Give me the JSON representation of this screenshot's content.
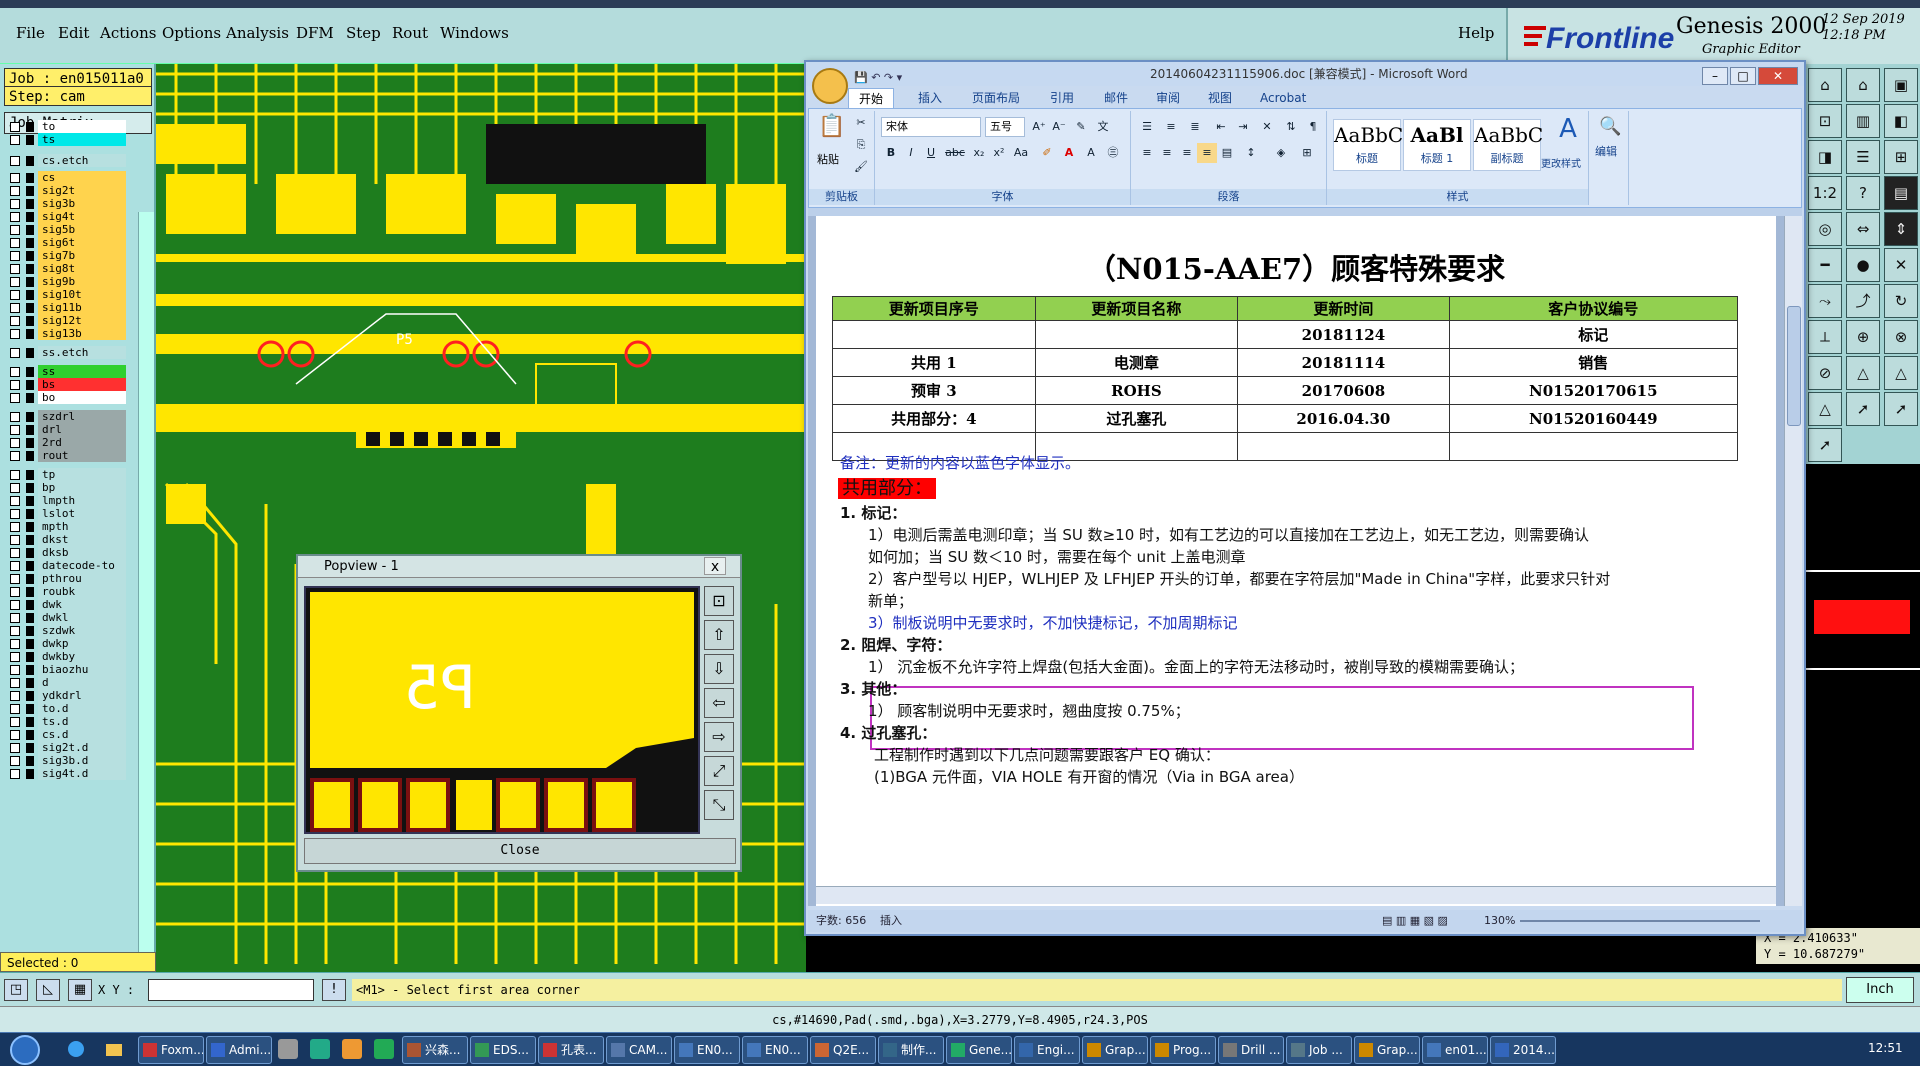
{
  "genesis": {
    "menus": [
      "File",
      "Edit",
      "Actions",
      "Options",
      "Analysis",
      "DFM",
      "Step",
      "Rout",
      "Windows"
    ],
    "help": "Help",
    "brand": {
      "logo_text": "Frontline",
      "product": "Genesis 2000",
      "subtitle": "Graphic Editor",
      "date": "12 Sep 2019",
      "time": "12:18 PM"
    },
    "job_label": "Job : en015011a0",
    "step_label": "Step: cam",
    "job_matrix": "Job Matrix ...",
    "layers": [
      {
        "name": "to",
        "color": "#ffffff"
      },
      {
        "name": "ts",
        "color": "#00e8e8"
      },
      {
        "name": "cs.etch",
        "color": "#b7e0e0"
      },
      {
        "name": "cs",
        "color": "#ffd34d"
      },
      {
        "name": "sig2t",
        "color": "#ffd34d"
      },
      {
        "name": "sig3b",
        "color": "#ffd34d"
      },
      {
        "name": "sig4t",
        "color": "#ffd34d"
      },
      {
        "name": "sig5b",
        "color": "#ffd34d"
      },
      {
        "name": "sig6t",
        "color": "#ffd34d"
      },
      {
        "name": "sig7b",
        "color": "#ffd34d"
      },
      {
        "name": "sig8t",
        "color": "#ffd34d"
      },
      {
        "name": "sig9b",
        "color": "#ffd34d"
      },
      {
        "name": "sig10t",
        "color": "#ffd34d"
      },
      {
        "name": "sig11b",
        "color": "#ffd34d"
      },
      {
        "name": "sig12t",
        "color": "#ffd34d"
      },
      {
        "name": "sig13b",
        "color": "#ffd34d"
      },
      {
        "name": "ss.etch",
        "color": "#b7e0e0"
      },
      {
        "name": "ss",
        "color": "#2fd02f"
      },
      {
        "name": "bs",
        "color": "#ff3030"
      },
      {
        "name": "bo",
        "color": "#ffffff"
      },
      {
        "name": "szdrl",
        "color": "#9aa8a8"
      },
      {
        "name": "drl",
        "color": "#9aa8a8"
      },
      {
        "name": "2rd",
        "color": "#9aa8a8"
      },
      {
        "name": "rout",
        "color": "#9aa8a8"
      },
      {
        "name": "tp",
        "color": "#b7e0e0"
      },
      {
        "name": "bp",
        "color": "#b7e0e0"
      },
      {
        "name": "lmpth",
        "color": "#b7e0e0"
      },
      {
        "name": "lslot",
        "color": "#b7e0e0"
      },
      {
        "name": "mpth",
        "color": "#b7e0e0"
      },
      {
        "name": "dkst",
        "color": "#b7e0e0"
      },
      {
        "name": "dksb",
        "color": "#b7e0e0"
      },
      {
        "name": "datecode-to",
        "color": "#b7e0e0"
      },
      {
        "name": "pthrou",
        "color": "#b7e0e0"
      },
      {
        "name": "roubk",
        "color": "#b7e0e0"
      },
      {
        "name": "dwk",
        "color": "#b7e0e0"
      },
      {
        "name": "dwkl",
        "color": "#b7e0e0"
      },
      {
        "name": "szdwk",
        "color": "#b7e0e0"
      },
      {
        "name": "dwkp",
        "color": "#b7e0e0"
      },
      {
        "name": "dwkby",
        "color": "#b7e0e0"
      },
      {
        "name": "biaozhu",
        "color": "#b7e0e0"
      },
      {
        "name": "d",
        "color": "#b7e0e0"
      },
      {
        "name": "ydkdrl",
        "color": "#b7e0e0"
      },
      {
        "name": "to.d",
        "color": "#b7e0e0"
      },
      {
        "name": "ts.d",
        "color": "#b7e0e0"
      },
      {
        "name": "cs.d",
        "color": "#b7e0e0"
      },
      {
        "name": "sig2t.d",
        "color": "#b7e0e0"
      },
      {
        "name": "sig3b.d",
        "color": "#b7e0e0"
      },
      {
        "name": "sig4t.d",
        "color": "#b7e0e0"
      }
    ],
    "selected": "Selected : 0",
    "popview": {
      "title": "Popview - 1",
      "close_x": "x",
      "close": "Close",
      "pad_label": "P5"
    },
    "board_label": "P5",
    "cmd": {
      "xy_label": "X Y :",
      "prompt": "<M1> - Select first area corner",
      "units": "Inch"
    },
    "coords": {
      "x": "X = 2.410633\"",
      "y": "Y = 10.687279\""
    },
    "status": "cs,#14690,Pad(.smd,.bga),X=3.2779,Y=8.4905,r24.3,POS"
  },
  "word": {
    "title": "20140604231115906.doc [兼容模式] - Microsoft Word",
    "tabs": [
      "开始",
      "插入",
      "页面布局",
      "引用",
      "邮件",
      "审阅",
      "视图",
      "Acrobat"
    ],
    "font_name": "宋体",
    "font_size": "五号",
    "groups": {
      "clipboard": "剪贴板",
      "paste": "粘贴",
      "font": "字体",
      "paragraph": "段落",
      "styles": "样式",
      "change_styles": "更改样式",
      "edit": "编辑"
    },
    "styles": [
      {
        "preview": "AaBbC",
        "name": "标题"
      },
      {
        "preview": "AaBl",
        "name": "标题 1"
      },
      {
        "preview": "AaBbC",
        "name": "副标题"
      }
    ],
    "doc": {
      "title": "（N015-AAE7）顾客特殊要求",
      "table_headers": [
        "更新项目序号",
        "更新项目名称",
        "更新时间",
        "客户协议编号"
      ],
      "table_rows": [
        [
          "",
          "",
          "20181124",
          "标记"
        ],
        [
          "共用 1",
          "电测章",
          "20181114",
          "销售"
        ],
        [
          "预审 3",
          "ROHS",
          "20170608",
          "N01520170615"
        ],
        [
          "共用部分：4",
          "过孔塞孔",
          "2016.04.30",
          "N01520160449"
        ],
        [
          "",
          "",
          "",
          ""
        ]
      ],
      "note": "备注：更新的内容以蓝色字体显示。",
      "section_common": "共用部分：",
      "h1": "1.   标记：",
      "p1a": "1）电测后需盖电测印章；当 SU 数≥10 时，如有工艺边的可以直接加在工艺边上，如无工艺边，则需要确认",
      "p1b": "如何加；当 SU 数＜10 时，需要在每个 unit 上盖电测章",
      "p1c": "2）客户型号以 HJEP，WLHJEP 及 LFHJEP 开头的订单，都要在字符层加\"Made in China\"字样，此要求只针对",
      "p1d": "新单；",
      "p1e": "3）制板说明中无要求时，不加快捷标记，不加周期标记",
      "h2": "2.   阻焊、字符：",
      "p2a": "1）  沉金板不允许字符上焊盘(包括大金面)。金面上的字符无法移动时，被削导致的模糊需要确认；",
      "h3": "3.   其他：",
      "p3a": "1）  顾客制说明中无要求时，翘曲度按  0.75%；",
      "h4": "4. 过孔塞孔：",
      "p4a": "工程制作时遇到以下几点问题需要跟客户 EQ 确认：",
      "p4b": "(1)BGA 元件面，VIA HOLE  有开窗的情况（Via in BGA area）"
    },
    "status": {
      "words": "字数: 656",
      "mode": "插入",
      "zoom": "130%"
    }
  },
  "taskbar": {
    "items": [
      "Foxm...",
      "Admi...",
      "",
      "",
      "",
      "",
      "兴森...",
      "EDS...",
      "孔表...",
      "CAM...",
      "EN0...",
      "EN0...",
      "Q2E...",
      "制作...",
      "Gene...",
      "Engi...",
      "Grap...",
      "Prog...",
      "Drill ...",
      "Job ...",
      "Grap...",
      "en01...",
      "2014..."
    ],
    "time": "12:51"
  }
}
